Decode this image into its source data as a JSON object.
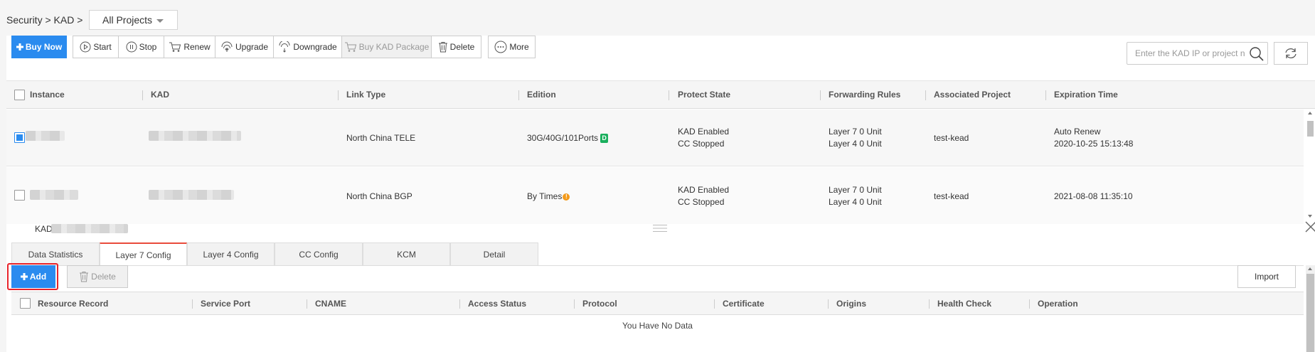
{
  "breadcrumb": {
    "text": "Security > KAD >"
  },
  "project_select": {
    "value": "All Projects"
  },
  "toolbar": {
    "buy_now": "Buy Now",
    "start": "Start",
    "stop": "Stop",
    "renew": "Renew",
    "upgrade": "Upgrade",
    "downgrade": "Downgrade",
    "buy_package": "Buy KAD Package",
    "delete": "Delete",
    "more": "More"
  },
  "search": {
    "placeholder": "Enter the KAD IP or project n"
  },
  "table": {
    "headers": {
      "instance": "Instance",
      "kad": "KAD",
      "link_type": "Link Type",
      "edition": "Edition",
      "protect_state": "Protect State",
      "forwarding_rules": "Forwarding Rules",
      "associated_project": "Associated Project",
      "expiration_time": "Expiration Time"
    },
    "rows": [
      {
        "checked": true,
        "link_type": "North China TELE",
        "edition": "30G/40G/101Ports",
        "edition_badge": "D",
        "protect_kad": "KAD Enabled",
        "protect_cc": "CC Stopped",
        "rule_l7": "Layer 7 0 Unit",
        "rule_l4": "Layer 4 0 Unit",
        "project": "test-kead",
        "expiration_line1": "Auto Renew",
        "expiration_line2": "2020-10-25 15:13:48"
      },
      {
        "checked": false,
        "link_type": "North China BGP",
        "edition": "By Times",
        "edition_badge": "!",
        "protect_kad": "KAD Enabled",
        "protect_cc": "CC Stopped",
        "rule_l7": "Layer 7 0 Unit",
        "rule_l4": "Layer 4 0 Unit",
        "project": "test-kead",
        "expiration_line1": "",
        "expiration_line2": "2021-08-08 11:35:10"
      }
    ]
  },
  "detail": {
    "title": "KAD",
    "tabs": [
      {
        "label": "Data Statistics"
      },
      {
        "label": "Layer 7 Config"
      },
      {
        "label": "Layer 4 Config"
      },
      {
        "label": "CC Config"
      },
      {
        "label": "KCM"
      },
      {
        "label": "Detail"
      }
    ],
    "active_tab": "Layer 7 Config",
    "add": "Add",
    "delete": "Delete",
    "import": "Import",
    "headers": {
      "resource_record": "Resource Record",
      "service_port": "Service Port",
      "cname": "CNAME",
      "access_status": "Access Status",
      "protocol": "Protocol",
      "certificate": "Certificate",
      "origins": "Origins",
      "health_check": "Health Check",
      "operation": "Operation"
    },
    "no_data": "You Have No Data"
  },
  "colors": {
    "primary": "#2a8bef",
    "active_tab_accent": "#e94b3c",
    "highlight": "#e8232a",
    "badge_green": "#1aaf5d",
    "warn_orange": "#f39a1a"
  }
}
